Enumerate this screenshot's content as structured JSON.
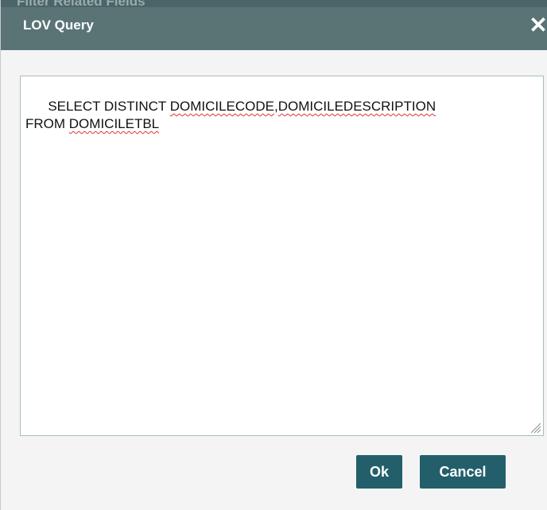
{
  "window": {
    "background_title": "Filter Related Fields",
    "title": "LOV Query",
    "close_glyph": "✕",
    "colors": {
      "title_bar": "#5a7476",
      "button": "#235f6a",
      "body": "#f4f4f4"
    }
  },
  "editor": {
    "line1_prefix": "SELECT DISTINCT ",
    "line1_word1": "DOMICILECODE",
    "line1_sep": ",",
    "line1_word2": "DOMICILEDESCRIPTION",
    "line2_prefix": "FROM ",
    "line2_word1": "DOMICILETBL",
    "resize_icon": "resize-grip-icon"
  },
  "buttons": {
    "ok_label": "Ok",
    "cancel_label": "Cancel"
  }
}
